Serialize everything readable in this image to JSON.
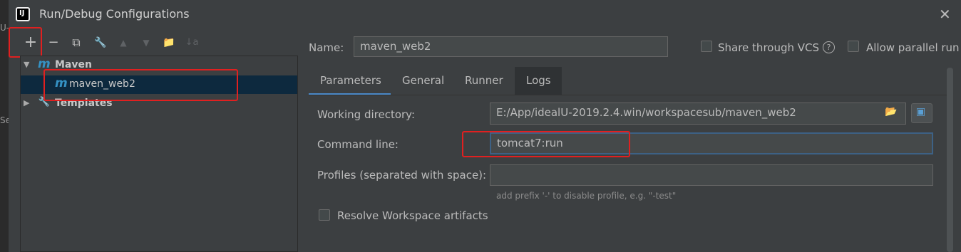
{
  "window": {
    "title": "Run/Debug Configurations",
    "app_icon_text": "IJ",
    "close_glyph": "✕"
  },
  "left_fragments": [
    "U-",
    "Se"
  ],
  "toolbar": {
    "add": "+",
    "remove": "−",
    "copy": "⧉",
    "edit": "🔧",
    "up": "▲",
    "down": "▼",
    "folder": "📁",
    "sort": "↓a"
  },
  "tree": {
    "maven_group": "Maven",
    "maven_logo": "m",
    "config_item": "maven_web2",
    "templates": "Templates"
  },
  "form": {
    "name_label": "Name:",
    "name_value": "maven_web2",
    "share_vcs_label": "Share through VCS",
    "help_glyph": "?",
    "parallel_label": "Allow parallel run"
  },
  "tabs": [
    {
      "label": "Parameters"
    },
    {
      "label": "General"
    },
    {
      "label": "Runner"
    },
    {
      "label": "Logs"
    }
  ],
  "parameters": {
    "working_dir_label": "Working directory:",
    "working_dir_value": "E:/App/idealU-2019.2.4.win/workspacesub/maven_web2",
    "command_line_label": "Command line:",
    "command_line_value": "tomcat7:run",
    "profiles_label": "Profiles (separated with space):",
    "profiles_value": "",
    "profiles_hint": "add prefix '-' to disable profile, e.g. \"-test\"",
    "resolve_label": "Resolve Workspace artifacts"
  },
  "colors": {
    "background": "#3c3f41",
    "selection": "#0d293e",
    "accent": "#4a88c7",
    "highlight_box": "#e02020",
    "maven_blue": "#3592c4"
  }
}
